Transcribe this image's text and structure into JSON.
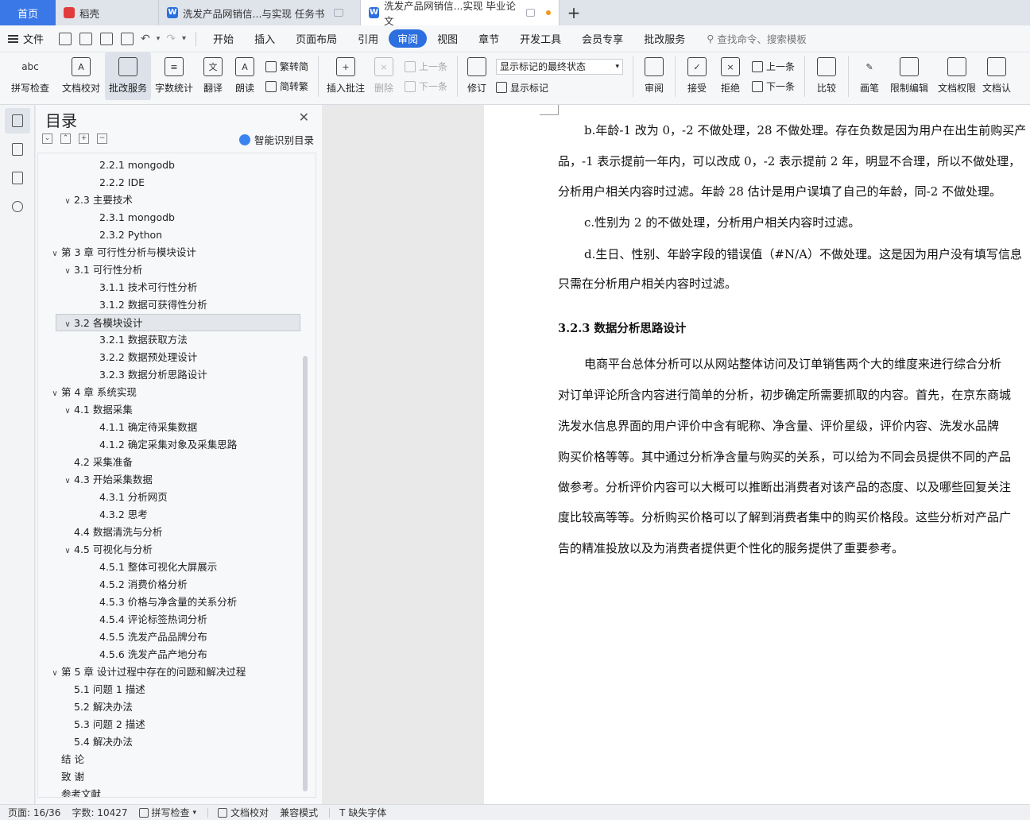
{
  "tabs": {
    "home": "首页",
    "items": [
      {
        "label": "稻壳",
        "icon": "docer-icon"
      },
      {
        "label": "洗发产品网销信...与实现 任务书",
        "icon": "writer-icon"
      },
      {
        "label": "洗发产品网销信...实现 毕业论文",
        "icon": "writer-icon"
      }
    ]
  },
  "menubar": {
    "file": "文件",
    "items": [
      "开始",
      "插入",
      "页面布局",
      "引用",
      "审阅",
      "视图",
      "章节",
      "开发工具",
      "会员专享",
      "批改服务"
    ],
    "active": "审阅",
    "search_placeholder": "查找命令、搜索模板"
  },
  "ribbon": {
    "spellcheck": "拼写检查",
    "doc_proof": "文档校对",
    "review_service": "批改服务",
    "word_count": "字数统计",
    "translate": "翻译",
    "read_aloud": "朗读",
    "trad_to_simp": "繁转简",
    "simp_to_trad": "简转繁",
    "insert_comment": "插入批注",
    "delete": "删除",
    "prev_comment": "上一条",
    "next_comment": "下一条",
    "track_changes": "修订",
    "markup_select": "显示标记的最终状态",
    "show_markup": "显示标记",
    "review": "审阅",
    "accept": "接受",
    "reject": "拒绝",
    "prev_change": "上一条",
    "next_change": "下一条",
    "compare": "比较",
    "ink": "画笔",
    "restrict_edit": "限制编辑",
    "doc_permission": "文档权限",
    "doc_cert": "文档认"
  },
  "toc": {
    "title": "目录",
    "smart": "智能识别目录",
    "items": [
      {
        "text": "2.2.1 mongodb",
        "level": 3,
        "chev": false
      },
      {
        "text": "2.2.2 IDE",
        "level": 3,
        "chev": false
      },
      {
        "text": "2.3 主要技术",
        "level": 2,
        "chev": true
      },
      {
        "text": "2.3.1 mongodb",
        "level": 3,
        "chev": false
      },
      {
        "text": "2.3.2 Python",
        "level": 3,
        "chev": false
      },
      {
        "text": "第 3 章  可行性分析与模块设计",
        "level": 1,
        "chev": true
      },
      {
        "text": "3.1  可行性分析",
        "level": 2,
        "chev": true
      },
      {
        "text": "3.1.1  技术可行性分析",
        "level": 3,
        "chev": false
      },
      {
        "text": "3.1.2  数据可获得性分析",
        "level": 3,
        "chev": false
      },
      {
        "text": "3.2  各模块设计",
        "level": 2,
        "chev": true,
        "selected": true
      },
      {
        "text": "3.2.1  数据获取方法",
        "level": 3,
        "chev": false
      },
      {
        "text": "3.2.2  数据预处理设计",
        "level": 3,
        "chev": false
      },
      {
        "text": "3.2.3  数据分析思路设计",
        "level": 3,
        "chev": false
      },
      {
        "text": "第 4 章  系统实现",
        "level": 1,
        "chev": true
      },
      {
        "text": "4.1 数据采集",
        "level": 2,
        "chev": true
      },
      {
        "text": "4.1.1 确定待采集数据",
        "level": 3,
        "chev": false
      },
      {
        "text": "4.1.2 确定采集对象及采集思路",
        "level": 3,
        "chev": false
      },
      {
        "text": "4.2 采集准备",
        "level": 2,
        "chev": false
      },
      {
        "text": "4.3 开始采集数据",
        "level": 2,
        "chev": true
      },
      {
        "text": "4.3.1 分析网页",
        "level": 3,
        "chev": false
      },
      {
        "text": "4.3.2 思考",
        "level": 3,
        "chev": false
      },
      {
        "text": "4.4 数据清洗与分析",
        "level": 2,
        "chev": false
      },
      {
        "text": "4.5  可视化与分析",
        "level": 2,
        "chev": true
      },
      {
        "text": "4.5.1  整体可视化大屏展示",
        "level": 3,
        "chev": false
      },
      {
        "text": "4.5.2 消费价格分析",
        "level": 3,
        "chev": false
      },
      {
        "text": "4.5.3 价格与净含量的关系分析",
        "level": 3,
        "chev": false
      },
      {
        "text": "4.5.4  评论标签热词分析",
        "level": 3,
        "chev": false
      },
      {
        "text": "4.5.5  洗发产品品牌分布",
        "level": 3,
        "chev": false
      },
      {
        "text": "4.5.6  洗发产品产地分布",
        "level": 3,
        "chev": false
      },
      {
        "text": "第 5 章  设计过程中存在的问题和解决过程",
        "level": 1,
        "chev": true
      },
      {
        "text": "5.1 问题 1 描述",
        "level": 2,
        "chev": false
      },
      {
        "text": "5.2 解决办法",
        "level": 2,
        "chev": false
      },
      {
        "text": "5.3 问题 2 描述",
        "level": 2,
        "chev": false
      },
      {
        "text": "5.4 解决办法",
        "level": 2,
        "chev": false
      },
      {
        "text": "结    论",
        "level": 1,
        "chev": false
      },
      {
        "text": "致    谢",
        "level": 1,
        "chev": false
      },
      {
        "text": "参考文献",
        "level": 1,
        "chev": false
      }
    ]
  },
  "document": {
    "lines": [
      {
        "text": "b.年龄-1 改为 0，-2 不做处理，28 不做处理。存在负数是因为用户在出生前购买产",
        "indent": true,
        "type": "p"
      },
      {
        "text": "品，-1 表示提前一年内，可以改成 0，-2 表示提前 2 年，明显不合理，所以不做处理，",
        "indent": false,
        "type": "p"
      },
      {
        "text": "分析用户相关内容时过滤。年龄 28 估计是用户误填了自己的年龄，同-2 不做处理。",
        "indent": false,
        "type": "p"
      },
      {
        "text": "c.性别为 2 的不做处理，分析用户相关内容时过滤。",
        "indent": true,
        "type": "p"
      },
      {
        "text": "d.生日、性别、年龄字段的错误值（#N/A）不做处理。这是因为用户没有填写信息",
        "indent": true,
        "type": "p"
      },
      {
        "text": "只需在分析用户相关内容时过滤。",
        "indent": false,
        "type": "p"
      },
      {
        "text": "3.2.3  数据分析思路设计",
        "indent": false,
        "type": "h"
      },
      {
        "text": "电商平台总体分析可以从网站整体访问及订单销售两个大的维度来进行综合分析",
        "indent": true,
        "type": "p"
      },
      {
        "text": "对订单评论所含内容进行简单的分析，初步确定所需要抓取的内容。首先，在京东商城",
        "indent": false,
        "type": "p"
      },
      {
        "text": "洗发水信息界面的用户评价中含有昵称、净含量、评价星级，评价内容、洗发水品牌",
        "indent": false,
        "type": "p"
      },
      {
        "text": "购买价格等等。其中通过分析净含量与购买的关系，可以给为不同会员提供不同的产品",
        "indent": false,
        "type": "p"
      },
      {
        "text": "做参考。分析评价内容可以大概可以推断出消费者对该产品的态度、以及哪些回复关注",
        "indent": false,
        "type": "p"
      },
      {
        "text": "度比较高等等。分析购买价格可以了解到消费者集中的购买价格段。这些分析对产品广",
        "indent": false,
        "type": "p"
      },
      {
        "text": "告的精准投放以及为消费者提供更个性化的服务提供了重要参考。",
        "indent": false,
        "type": "p"
      }
    ]
  },
  "status": {
    "page": "页面: 16/36",
    "words": "字数: 10427",
    "spellcheck": "拼写检查",
    "proof": "文档校对",
    "compat": "兼容模式",
    "missing_font": "缺失字体"
  }
}
